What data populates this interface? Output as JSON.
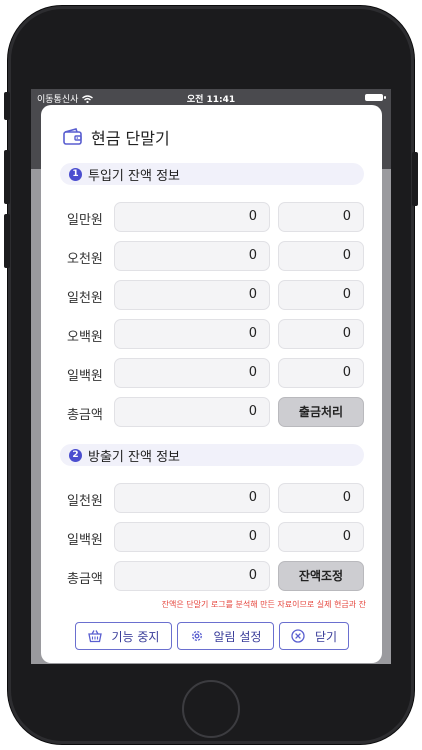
{
  "status_bar": {
    "carrier": "이동통신사",
    "time": "오전 11:41"
  },
  "modal": {
    "title": "현금 단말기",
    "sections": [
      {
        "number": "1",
        "label": "투입기 잔액 정보",
        "rows": [
          {
            "label": "일만원",
            "value1": "0",
            "value2": "0"
          },
          {
            "label": "오천원",
            "value1": "0",
            "value2": "0"
          },
          {
            "label": "일천원",
            "value1": "0",
            "value2": "0"
          },
          {
            "label": "오백원",
            "value1": "0",
            "value2": "0"
          },
          {
            "label": "일백원",
            "value1": "0",
            "value2": "0"
          }
        ],
        "total_label": "총금액",
        "total_value": "0",
        "action_label": "출금처리"
      },
      {
        "number": "2",
        "label": "방출기 잔액 정보",
        "rows": [
          {
            "label": "일천원",
            "value1": "0",
            "value2": "0"
          },
          {
            "label": "일백원",
            "value1": "0",
            "value2": "0"
          }
        ],
        "total_label": "총금액",
        "total_value": "0",
        "action_label": "잔액조정"
      }
    ],
    "notice": "잔액은 단말기 로그를 분석해 만든 자료이므로 실제 현금과 잔",
    "buttons": {
      "stop": "기능 중지",
      "alert_settings": "알림 설정",
      "close": "닫기"
    }
  },
  "icons": {
    "title": "wallet-icon",
    "stop": "basket-icon",
    "alert_settings": "gear-icon",
    "close": "close-circle-icon"
  },
  "colors": {
    "accent": "#4b4ecf",
    "notice": "#e5453c",
    "button_border": "#6a6fcf"
  }
}
